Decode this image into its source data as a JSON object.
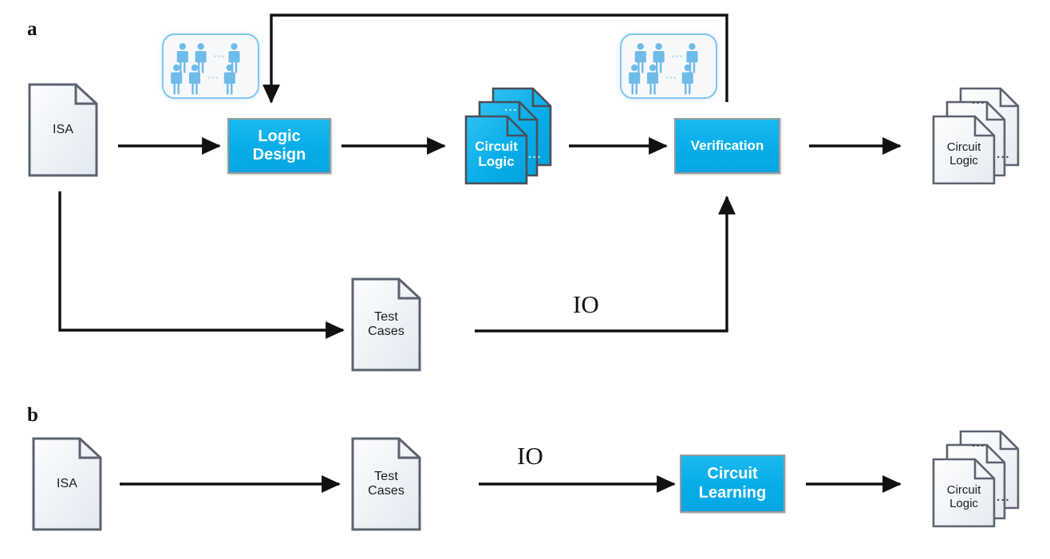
{
  "figure": {
    "panels": [
      {
        "id": "a",
        "letter": "a"
      },
      {
        "id": "b",
        "letter": "b"
      }
    ]
  },
  "panel_a": {
    "letter": "a",
    "nodes": {
      "isa": {
        "label_line1": "ISA",
        "label_line2": "",
        "kind": "document",
        "color": "#eef2f7"
      },
      "logic_design": {
        "label_line1": "Logic",
        "label_line2": "Design",
        "kind": "process",
        "color": "#06ade9"
      },
      "circuit_logic": {
        "label_line1": "Circuit",
        "label_line2": "Logic",
        "kind": "document-stack",
        "color": "#06ade9"
      },
      "verification": {
        "label_line1": "Verification",
        "label_line2": "",
        "kind": "process",
        "color": "#06ade9"
      },
      "circuit_logic_out": {
        "label_line1": "Circuit",
        "label_line2": "Logic",
        "kind": "document-stack",
        "color": "#eef2f7"
      },
      "test_cases": {
        "label_line1": "Test",
        "label_line2": "Cases",
        "kind": "document",
        "color": "#eef2f7"
      }
    },
    "people_groups": [
      {
        "id": "engineers-logic-design",
        "count_visible": 6
      },
      {
        "id": "engineers-verification",
        "count_visible": 6
      }
    ],
    "edge_labels": {
      "io": "IO"
    },
    "ellipses": {
      "stack_mid": "...",
      "stack_top": "..."
    }
  },
  "panel_b": {
    "letter": "b",
    "nodes": {
      "isa": {
        "label_line1": "ISA",
        "label_line2": "",
        "kind": "document",
        "color": "#eef2f7"
      },
      "test_cases": {
        "label_line1": "Test",
        "label_line2": "Cases",
        "kind": "document",
        "color": "#eef2f7"
      },
      "circuit_learning": {
        "label_line1": "Circuit",
        "label_line2": "Learning",
        "kind": "process",
        "color": "#06ade9"
      },
      "circuit_logic_out": {
        "label_line1": "Circuit",
        "label_line2": "Logic",
        "kind": "document-stack",
        "color": "#eef2f7"
      }
    },
    "edge_labels": {
      "io": "IO"
    },
    "ellipses": {
      "stack_mid": "...",
      "stack_top": "..."
    }
  },
  "colors": {
    "accent_blue": "#06ade9",
    "doc_fill": "#eef2f7",
    "doc_stroke": "#5c6270",
    "box_border": "#9a9a9a",
    "arrow": "#111111",
    "people_blue": "#66b8e8",
    "people_border": "#7ec8f2"
  }
}
